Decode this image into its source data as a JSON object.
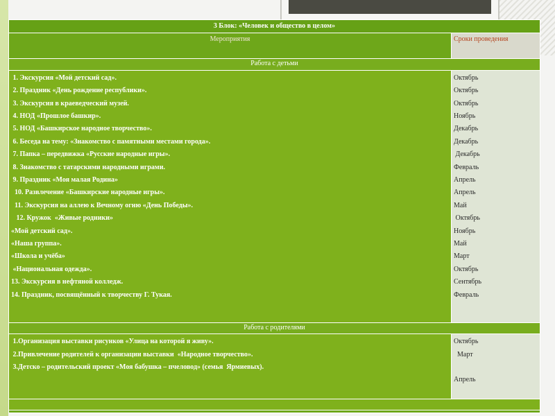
{
  "block_title": "3 Блок: «Человек и общество в целом»",
  "columns": {
    "events": "Мероприятия",
    "dates": "Сроки проведения"
  },
  "sections": [
    {
      "title": "Работа с детьми",
      "items": [
        {
          "text": " 1. Экскурсия «Мой детский сад».",
          "date": "Октябрь"
        },
        {
          "text": " 2. Праздник «День рождение республики».",
          "date": "Октябрь"
        },
        {
          "text": " 3. Экскурсия в краеведческий музей.",
          "date": "Октябрь"
        },
        {
          "text": " 4. НОД «Прошлое башкир».",
          "date": "Ноябрь"
        },
        {
          "text": " 5. НОД «Башкирское народное творчество».",
          "date": "Декабрь"
        },
        {
          "text": " 6. Беседа на тему: «Знакомство с памятными местами города».",
          "date": "Декабрь"
        },
        {
          "text": " 7. Папка – передвижка «Русские народные игры».",
          "date": " Декабрь"
        },
        {
          "text": " 8. Знакомство с татарскими народными играми.",
          "date": "Февраль"
        },
        {
          "text": " 9. Праздник «Моя малая Родина»",
          "date": "Апрель"
        },
        {
          "text": "  10. Развлечение «Башкирские народные игры».",
          "date": "Апрель"
        },
        {
          "text": "  11. Экскурсия на аллею к Вечному огню «День Победы».",
          "date": "Май"
        },
        {
          "text": "   12. Кружок  «Живые родники»",
          "date": " Октябрь"
        },
        {
          "text": "«Мой детский сад».",
          "date": "Ноябрь"
        },
        {
          "text": "«Наша группа».",
          "date": "Май"
        },
        {
          "text": "«Школа и учёба»",
          "date": "Март"
        },
        {
          "text": " «Национальная одежда».",
          "date": "Октябрь"
        },
        {
          "text": "13. Экскурсия в нефтяной колледж.",
          "date": "Сентябрь"
        },
        {
          "text": "14. Праздник, посвящённый к творчеству Г. Тукая.",
          "date": "Февраль"
        }
      ]
    },
    {
      "title": "Работа с родителями",
      "items": [
        {
          "text": " 1.Организация выставки рисунков «Улица на которой я живу».",
          "date": "Октябрь"
        },
        {
          "text": " 2.Привлечение родителей к организации выставки  «Народное творчество».",
          "date": "  Март"
        },
        {
          "text": " 3.Детско – родительский проект «Моя бабушка – пчеловод» (семья  Ярмиевых).",
          "date": ""
        },
        {
          "text": "",
          "date": "Апрель"
        }
      ]
    }
  ]
}
